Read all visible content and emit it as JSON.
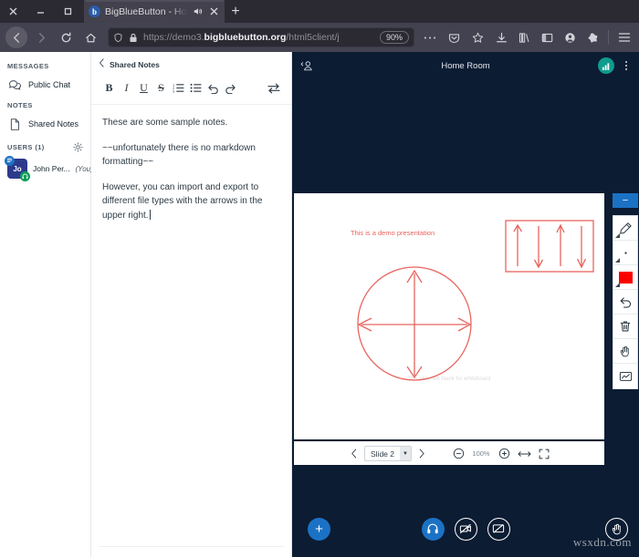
{
  "browser": {
    "window_controls": [
      "close",
      "minimize",
      "maximize"
    ],
    "tab": {
      "title": "BigBlueButton - Home",
      "favicon_letter": "b",
      "audio_icon": "speaker-icon",
      "close_icon": "close-icon"
    },
    "new_tab_label": "+",
    "nav": {
      "back_icon": "back-arrow-icon",
      "forward_icon": "forward-arrow-icon",
      "reload_icon": "reload-icon",
      "home_icon": "home-icon"
    },
    "url": {
      "scheme": "https://",
      "subdomain": "demo3.",
      "domain": "bigbluebutton.org",
      "path": "/html5client/j",
      "shield_icon": "shield-icon",
      "lock_icon": "lock-icon",
      "zoom_level": "90%",
      "more_icon": "ellipsis-icon",
      "pocket_icon": "pocket-icon",
      "bookmark_icon": "star-icon"
    },
    "toolbar_icons": [
      "download-icon",
      "library-icon",
      "sidebar-icon",
      "account-icon",
      "extension-icon",
      "menu-icon"
    ]
  },
  "sidebar": {
    "messages_heading": "MESSAGES",
    "public_chat": "Public Chat",
    "notes_heading": "NOTES",
    "shared_notes": "Shared Notes",
    "users_heading": "USERS (1)",
    "settings_icon": "gear-icon",
    "user": {
      "initials": "Jo",
      "name": "John Per...",
      "you_label": "(You)"
    }
  },
  "notes": {
    "panel_title": "Shared Notes",
    "back_icon": "chevron-left-icon",
    "toolbar": {
      "bold": "B",
      "italic": "I",
      "underline": "U",
      "strikethrough": "S",
      "ordered_list": "ordered-list-icon",
      "bullet_list": "bullet-list-icon",
      "undo": "undo-icon",
      "redo": "redo-icon",
      "import_export": "import-export-icon"
    },
    "paragraphs": [
      "These are some sample notes.",
      "~~unfortunately there is no markdown formatting~~",
      "However, you can import and export to different file types with the arrows in the upper right."
    ]
  },
  "meeting": {
    "title": "Home Room",
    "user_toggle_icon": "user-collapse-icon",
    "connection_icon": "signal-bars-icon",
    "connection_color": "#0f9b8e",
    "options_icon": "kebab-menu-icon",
    "slide": {
      "annotation_text": "This is a demo presentation",
      "blank_note": "This slide left blank for whiteboard",
      "annotation_color": "#e8645f"
    },
    "whiteboard_tools": {
      "minimize": "−",
      "items": [
        "pencil-icon",
        "thickness-dot-icon",
        "color-swatch",
        "undo-icon",
        "trash-icon",
        "pan-hand-icon",
        "multiuser-whiteboard-icon"
      ],
      "active_color": "#fc0000"
    },
    "presentation_controls": {
      "prev_icon": "chevron-left-icon",
      "slide_label": "Slide 2",
      "dropdown_icon": "chevron-down-icon",
      "next_icon": "chevron-right-icon",
      "zoom_out_icon": "minus-circle-icon",
      "zoom_value": "100%",
      "zoom_in_icon": "plus-circle-icon",
      "fit_width_icon": "fit-width-icon",
      "fullscreen_icon": "fullscreen-icon"
    },
    "actions": {
      "add_label": "+",
      "audio_icon": "headset-icon",
      "video_icon": "camera-off-icon",
      "screenshare_icon": "screenshare-off-icon",
      "raise_hand_icon": "raise-hand-icon",
      "accent_color": "#1b72c4"
    },
    "watermark": "wsxdn.com"
  }
}
